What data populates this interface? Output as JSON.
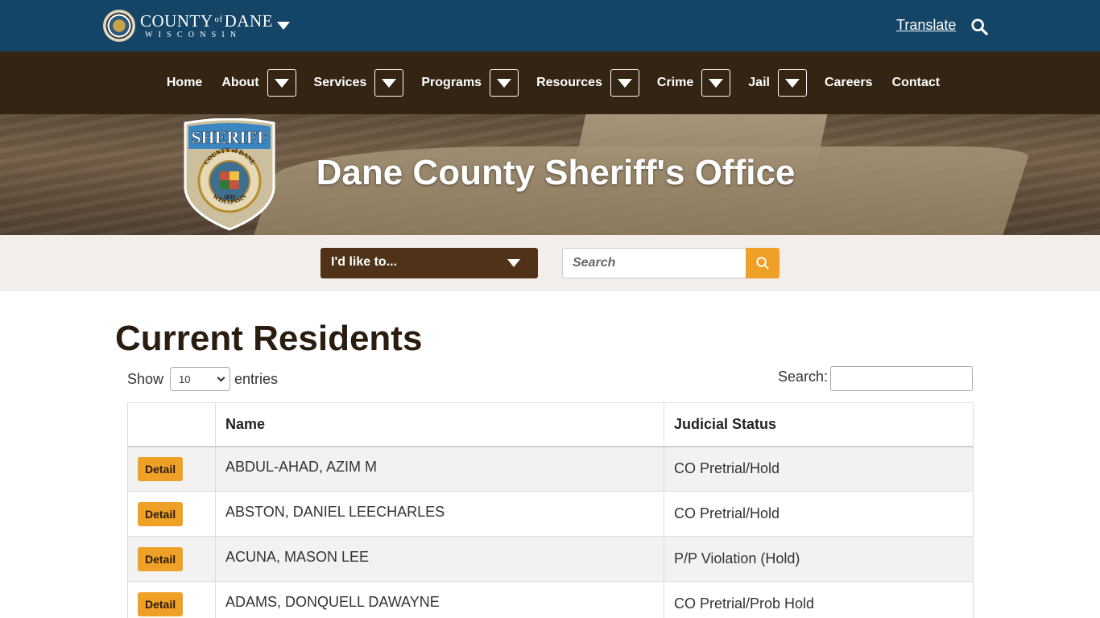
{
  "header": {
    "county_name_left": "COUNTY",
    "county_name_of": "of",
    "county_name_right": "DANE",
    "county_state": "WISCONSIN",
    "translate_label": "Translate",
    "search_icon": "search-icon",
    "brand_color": "#144466"
  },
  "nav": {
    "items": [
      {
        "label": "Home",
        "has_dropdown": false
      },
      {
        "label": "About",
        "has_dropdown": true
      },
      {
        "label": "Services",
        "has_dropdown": true
      },
      {
        "label": "Programs",
        "has_dropdown": true
      },
      {
        "label": "Resources",
        "has_dropdown": true
      },
      {
        "label": "Crime",
        "has_dropdown": true
      },
      {
        "label": "Jail",
        "has_dropdown": true
      },
      {
        "label": "Careers",
        "has_dropdown": false
      },
      {
        "label": "Contact",
        "has_dropdown": false
      }
    ],
    "background": "#332413"
  },
  "hero": {
    "badge_top_text": "SHERIFF",
    "badge_ring_text": "COUNTY of DANE",
    "badge_bottom_text": "WISCONSIN",
    "badge_year": "1839",
    "title": "Dane County Sheriff's Office"
  },
  "utility": {
    "like_to_label": "I'd like to...",
    "search_placeholder": "Search",
    "accent": "#eea126"
  },
  "content": {
    "page_title": "Current Residents",
    "show_label": "Show",
    "entries_label": "entries",
    "page_size": "10",
    "search_label": "Search:",
    "search_value": "",
    "table": {
      "columns": [
        "",
        "Name",
        "Judicial Status"
      ],
      "rows": [
        {
          "action": "Detail",
          "name": "ABDUL-AHAD, AZIM M",
          "status": "CO Pretrial/Hold"
        },
        {
          "action": "Detail",
          "name": "ABSTON, DANIEL LEECHARLES",
          "status": "CO Pretrial/Hold"
        },
        {
          "action": "Detail",
          "name": "ACUNA, MASON LEE",
          "status": "P/P Violation (Hold)"
        },
        {
          "action": "Detail",
          "name": "ADAMS, DONQUELL DAWAYNE",
          "status": "CO Pretrial/Prob Hold"
        }
      ]
    }
  }
}
